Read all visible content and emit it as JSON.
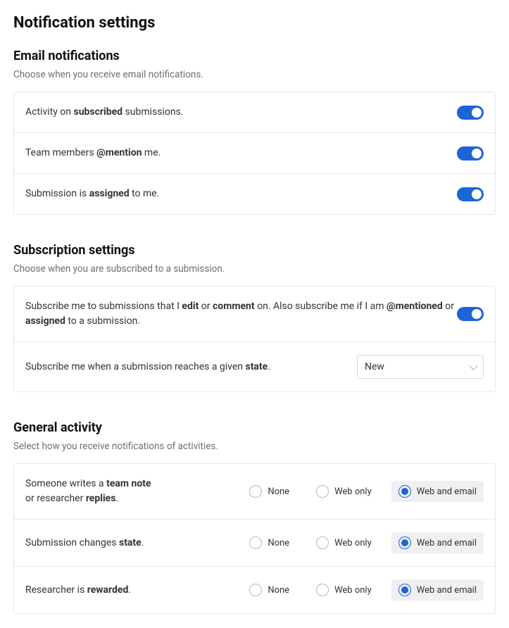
{
  "page_title": "Notification settings",
  "email": {
    "heading": "Email notifications",
    "sub": "Choose when you receive email notifications.",
    "items": [
      {
        "label_html": "Activity on <b>subscribed</b> submissions.",
        "on": true
      },
      {
        "label_html": "Team members <b>@mention</b> me.",
        "on": true
      },
      {
        "label_html": "Submission is <b>assigned</b> to me.",
        "on": true
      }
    ]
  },
  "subscription": {
    "heading": "Subscription settings",
    "sub": "Choose when you are subscribed to a submission.",
    "row1_label_html": "Subscribe me to submissions that I <b>edit</b> or <b>comment</b> on. Also subscribe me if I am <b>@mentioned</b> or <b>assigned</b> to a submission.",
    "row1_on": true,
    "row2_label_html": "Subscribe me when a submission reaches a given <b>state</b>.",
    "row2_selected": "New"
  },
  "general": {
    "heading": "General activity",
    "sub": "Select how you receive notifications of activities.",
    "options": [
      "None",
      "Web only",
      "Web and email"
    ],
    "rows": [
      {
        "label_html": "Someone writes a <b>team note</b><br>or researcher <b>replies</b>.",
        "selected": 2
      },
      {
        "label_html": "Submission changes <b>state</b>.",
        "selected": 2
      },
      {
        "label_html": "Researcher is <b>rewarded</b>.",
        "selected": 2
      }
    ]
  }
}
